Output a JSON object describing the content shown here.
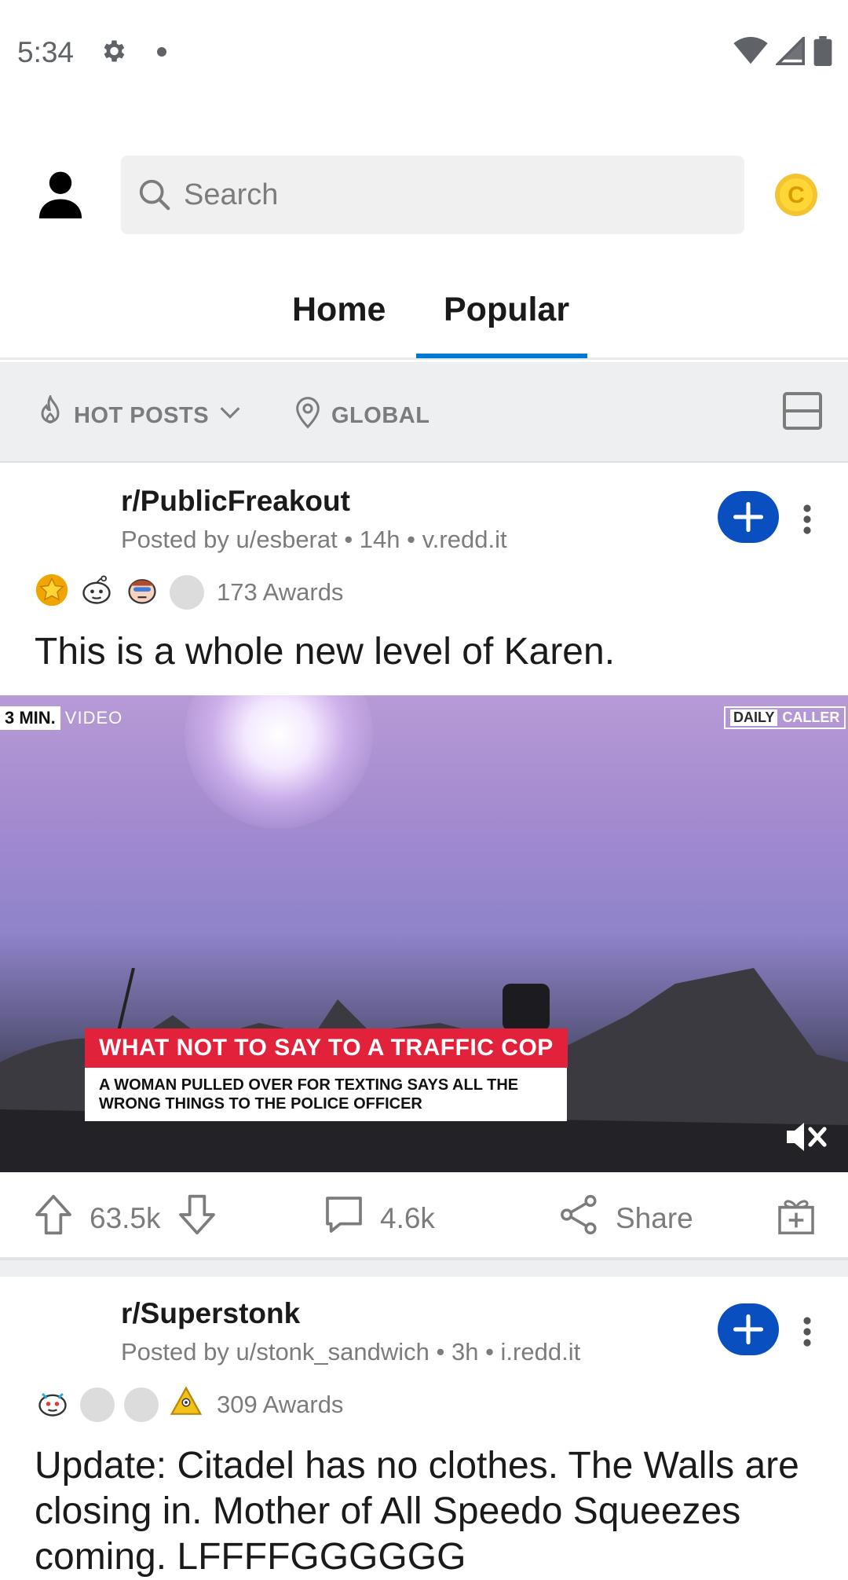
{
  "status_bar": {
    "time": "5:34"
  },
  "header": {
    "search_placeholder": "Search",
    "coin_label": "C"
  },
  "tabs": [
    {
      "label": "Home"
    },
    {
      "label": "Popular"
    }
  ],
  "filters": {
    "sort_label": "HOT POSTS",
    "location_label": "GLOBAL"
  },
  "posts": [
    {
      "subreddit": "r/PublicFreakout",
      "meta": "Posted by u/esberat • 14h • v.redd.it",
      "awards_count": "173 Awards",
      "title": "This is a whole new level of Karen.",
      "video": {
        "tag_left": "3 MIN.",
        "tag_right": "VIDEO",
        "brand_a": "DAILY",
        "brand_b": "CALLER",
        "headline": "WHAT NOT TO SAY TO A TRAFFIC COP",
        "subheadline": "A WOMAN PULLED OVER FOR TEXTING SAYS ALL THE WRONG THINGS TO THE POLICE OFFICER"
      },
      "votes": "63.5k",
      "comments": "4.6k",
      "share_label": "Share"
    },
    {
      "subreddit": "r/Superstonk",
      "meta": "Posted by u/stonk_sandwich • 3h • i.redd.it",
      "awards_count": "309 Awards",
      "title": "Update: Citadel has no clothes. The Walls are closing in. Mother of All Speedo Squeezes coming. LFFFFGGGGGG"
    }
  ],
  "colors": {
    "accent": "#0079d3",
    "join_button": "#0a4fbf",
    "muted_text": "#7c7c7c",
    "headline_red": "#e2223b"
  }
}
